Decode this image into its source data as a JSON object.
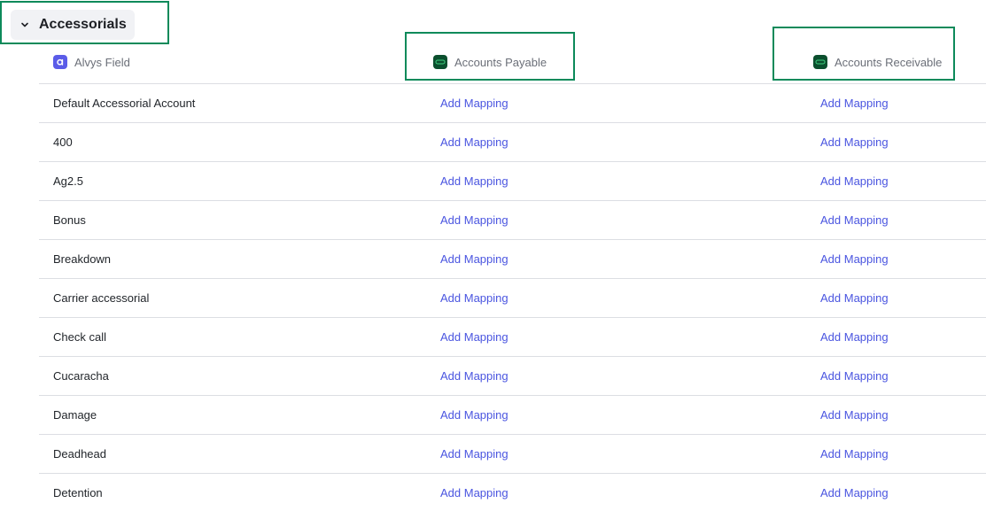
{
  "section": {
    "title": "Accessorials"
  },
  "columns": {
    "alvys_field": "Alvys Field",
    "accounts_payable": "Accounts Payable",
    "accounts_receivable": "Accounts Receivable"
  },
  "rows": [
    {
      "name": "Default Accessorial Account",
      "ap": "Add Mapping",
      "ar": "Add Mapping"
    },
    {
      "name": "400",
      "ap": "Add Mapping",
      "ar": "Add Mapping"
    },
    {
      "name": "Ag2.5",
      "ap": "Add Mapping",
      "ar": "Add Mapping"
    },
    {
      "name": "Bonus",
      "ap": "Add Mapping",
      "ar": "Add Mapping"
    },
    {
      "name": "Breakdown",
      "ap": "Add Mapping",
      "ar": "Add Mapping"
    },
    {
      "name": "Carrier accessorial",
      "ap": "Add Mapping",
      "ar": "Add Mapping"
    },
    {
      "name": "Check call",
      "ap": "Add Mapping",
      "ar": "Add Mapping"
    },
    {
      "name": "Cucaracha",
      "ap": "Add Mapping",
      "ar": "Add Mapping"
    },
    {
      "name": "Damage",
      "ap": "Add Mapping",
      "ar": "Add Mapping"
    },
    {
      "name": "Deadhead",
      "ap": "Add Mapping",
      "ar": "Add Mapping"
    },
    {
      "name": "Detention",
      "ap": "Add Mapping",
      "ar": "Add Mapping"
    }
  ],
  "icons": {
    "collapse": "chevron-down-icon",
    "alvys": "alvys-logo-icon",
    "quickbooks": "quickbooks-logo-icon"
  },
  "colors": {
    "link": "#4a55e0",
    "highlight": "#0c8a5a",
    "alvys_brand": "#5b5ce8",
    "qb_brand": "#0b4f2e"
  }
}
